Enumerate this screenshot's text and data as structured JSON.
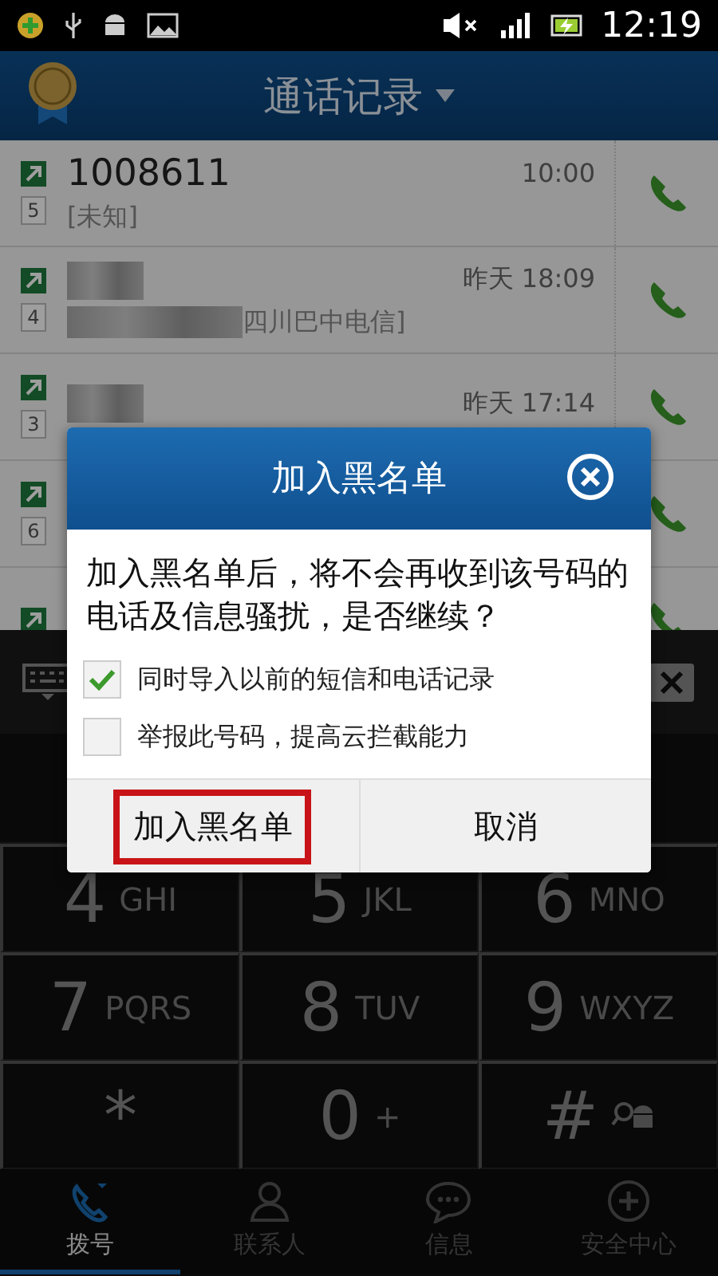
{
  "status_bar": {
    "time": "12:19"
  },
  "header": {
    "title": "通话记录"
  },
  "call_log": [
    {
      "count": "5",
      "redacted": false,
      "name": "1008611",
      "subtitle": "[未知]",
      "time": "10:00"
    },
    {
      "count": "4",
      "redacted": true,
      "subtitle": "四川巴中电信]",
      "time": "昨天 18:09"
    },
    {
      "count": "3",
      "redacted": true,
      "time": "昨天 17:14"
    },
    {
      "count": "6",
      "redacted": false
    },
    {
      "redacted": false
    }
  ],
  "keypad": [
    {
      "kind": "letters",
      "digit": "4",
      "letters": "GHI"
    },
    {
      "kind": "letters",
      "digit": "5",
      "letters": "JKL"
    },
    {
      "kind": "letters",
      "digit": "6",
      "letters": "MNO"
    },
    {
      "kind": "letters",
      "digit": "7",
      "letters": "PQRS"
    },
    {
      "kind": "letters",
      "digit": "8",
      "letters": "TUV"
    },
    {
      "kind": "letters",
      "digit": "9",
      "letters": "WXYZ"
    },
    {
      "kind": "plain",
      "digit": "*"
    },
    {
      "kind": "letters",
      "digit": "0",
      "letters": "+"
    },
    {
      "kind": "icon",
      "digit": "#"
    }
  ],
  "tabs": [
    {
      "label": "拨号",
      "selected": true
    },
    {
      "label": "联系人",
      "selected": false
    },
    {
      "label": "信息",
      "selected": false
    },
    {
      "label": "安全中心",
      "selected": false
    }
  ],
  "dialog": {
    "title": "加入黑名单",
    "message": "加入黑名单后，将不会再收到该号码的电话及信息骚扰，是否继续？",
    "options": [
      {
        "label": "同时导入以前的短信和电话记录",
        "checked": true
      },
      {
        "label": "举报此号码，提高云拦截能力",
        "checked": false
      }
    ],
    "buttons": [
      {
        "label": "加入黑名单",
        "highlighted": true
      },
      {
        "label": "取消",
        "highlighted": false
      }
    ]
  }
}
